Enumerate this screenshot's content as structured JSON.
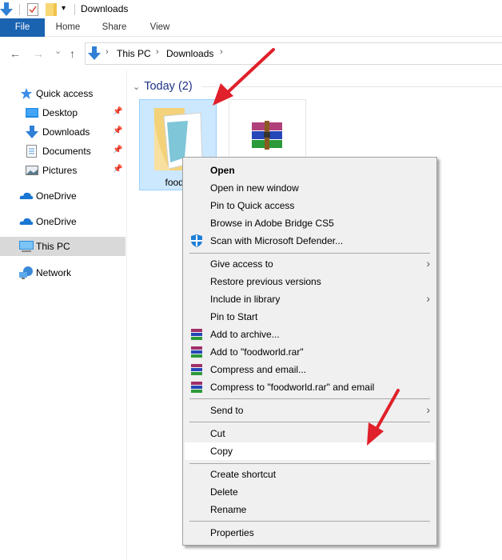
{
  "window": {
    "title": "Downloads",
    "quick_access_toolbar": [
      "downloads-icon",
      "properties-icon",
      "new-folder-icon",
      "customize-dropdown-icon"
    ]
  },
  "ribbon": {
    "tabs": [
      {
        "label": "File",
        "active": true
      },
      {
        "label": "Home"
      },
      {
        "label": "Share"
      },
      {
        "label": "View"
      }
    ]
  },
  "navigation": {
    "back": "←",
    "forward": "→",
    "recent": "⌄",
    "up": "↑",
    "breadcrumb": [
      "This PC",
      "Downloads"
    ],
    "separator": "›"
  },
  "sidebar": {
    "items": [
      {
        "label": "Quick access",
        "icon": "star-icon"
      },
      {
        "label": "Desktop",
        "icon": "desktop-icon",
        "pinned": true
      },
      {
        "label": "Downloads",
        "icon": "download-icon",
        "pinned": true
      },
      {
        "label": "Documents",
        "icon": "documents-icon",
        "pinned": true
      },
      {
        "label": "Pictures",
        "icon": "pictures-icon",
        "pinned": true
      },
      {
        "label": "OneDrive",
        "icon": "onedrive-icon"
      },
      {
        "label": "OneDrive",
        "icon": "onedrive-icon"
      },
      {
        "label": "This PC",
        "icon": "computer-icon",
        "selected": true
      },
      {
        "label": "Network",
        "icon": "network-icon"
      }
    ],
    "pin_glyph": "📌"
  },
  "content": {
    "group": {
      "chevron": "⌄",
      "title": "Today (2)"
    },
    "files": [
      {
        "name": "foodw",
        "type": "folder",
        "selected": true
      },
      {
        "name": "",
        "type": "rar-archive"
      }
    ]
  },
  "context_menu": {
    "groups": [
      [
        {
          "label": "Open",
          "bold": true
        },
        {
          "label": "Open in new window"
        },
        {
          "label": "Pin to Quick access"
        },
        {
          "label": "Browse in Adobe Bridge CS5"
        },
        {
          "label": "Scan with Microsoft Defender...",
          "icon": "defender-shield-icon"
        }
      ],
      [
        {
          "label": "Give access to",
          "submenu": true
        },
        {
          "label": "Restore previous versions"
        },
        {
          "label": "Include in library",
          "submenu": true
        },
        {
          "label": "Pin to Start"
        },
        {
          "label": "Add to archive...",
          "icon": "winrar-icon"
        },
        {
          "label": "Add to \"foodworld.rar\"",
          "icon": "winrar-icon"
        },
        {
          "label": "Compress and email...",
          "icon": "winrar-icon"
        },
        {
          "label": "Compress to \"foodworld.rar\" and email",
          "icon": "winrar-icon"
        }
      ],
      [
        {
          "label": "Send to",
          "submenu": true
        }
      ],
      [
        {
          "label": "Cut"
        },
        {
          "label": "Copy",
          "highlighted": true
        }
      ],
      [
        {
          "label": "Create shortcut"
        },
        {
          "label": "Delete"
        },
        {
          "label": "Rename"
        }
      ],
      [
        {
          "label": "Properties"
        }
      ]
    ],
    "submenu_arrow": "›"
  },
  "annotations": {
    "arrow_color": "#e0202a",
    "arrows": [
      "pointing-to-folder",
      "pointing-to-copy"
    ]
  },
  "colors": {
    "file_tab": "#1a63b0",
    "selection_fill": "#cce8ff",
    "selection_border": "#99d1ff",
    "group_title": "#1e3287",
    "menu_bg": "#f0f0f0"
  }
}
